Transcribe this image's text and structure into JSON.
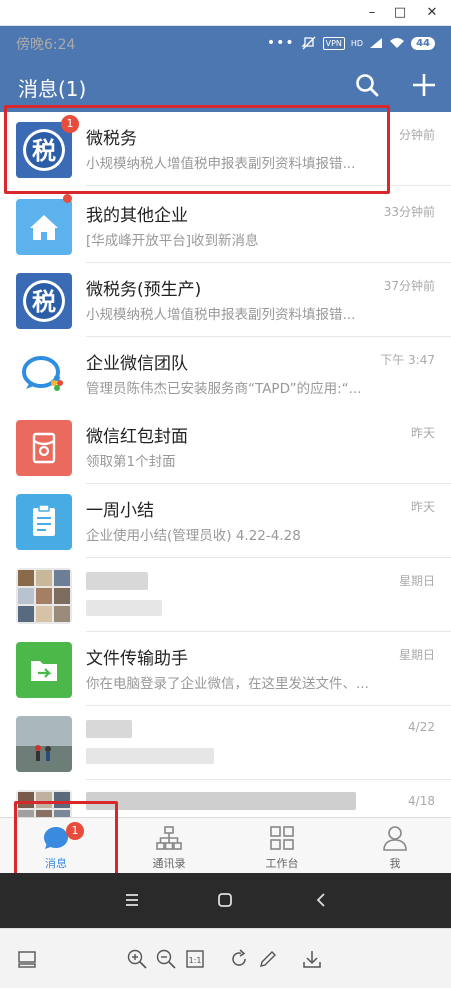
{
  "window": {
    "minimize": "–",
    "maximize": "□",
    "close": "✕"
  },
  "status_bar": {
    "time": "傍晚6:24",
    "vpn": "VPN",
    "hd": "HD",
    "battery": "44",
    "dots": "•••"
  },
  "header": {
    "title": "消息(1)",
    "icons": [
      "search-icon",
      "plus-icon"
    ]
  },
  "messages": [
    {
      "name": "微税务",
      "preview": "小规模纳税人增值税申报表副列资料填报错...",
      "time": "分钟前",
      "badge": "1",
      "avatar": "tax-icon",
      "avatar_color": "#2c5ea8"
    },
    {
      "name": "我的其他企业",
      "preview": "[华成峰开放平台]收到新消息",
      "time": "33分钟前",
      "avatar": "home-icon",
      "avatar_color": "#5bb2ec"
    },
    {
      "name": "微税务(预生产)",
      "preview": "小规模纳税人增值税申报表副列资料填报错...",
      "time": "37分钟前",
      "avatar": "tax-icon",
      "avatar_color": "#2c5ea8"
    },
    {
      "name": "企业微信团队",
      "preview": "管理员陈伟杰已安装服务商“TAPD”的应用:“...",
      "time": "下午 3:47",
      "avatar": "wework-logo-icon"
    },
    {
      "name": "微信红包封面",
      "preview": "领取第1个封面",
      "time": "昨天",
      "avatar": "red-packet-icon",
      "avatar_color": "#ea6a5d"
    },
    {
      "name": "一周小结",
      "preview": "企业使用小结(管理员收) 4.22-4.28",
      "time": "昨天",
      "avatar": "clipboard-icon",
      "avatar_color": "#48abe3"
    },
    {
      "name": "",
      "preview": "",
      "time": "星期日",
      "avatar": "group-avatar-icon"
    },
    {
      "name": "文件传输助手",
      "preview": "你在电脑登录了企业微信，在这里发送文件、...",
      "time": "星期日",
      "avatar": "folder-transfer-icon",
      "avatar_color": "#4cb849"
    },
    {
      "name": "",
      "preview": "",
      "time": "4/22",
      "avatar": "photo-avatar-icon"
    },
    {
      "name": "",
      "preview": "",
      "time": "4/18",
      "avatar": "group-avatar-icon"
    }
  ],
  "tabs": [
    {
      "label": "消息",
      "icon": "chat-bubble-icon",
      "badge": "1",
      "active": true
    },
    {
      "label": "通讯录",
      "icon": "org-chart-icon"
    },
    {
      "label": "工作台",
      "icon": "grid-icon"
    },
    {
      "label": "我",
      "icon": "person-icon"
    }
  ],
  "android_nav": [
    "menu-icon",
    "home-square-icon",
    "back-chevron-icon"
  ],
  "emulator_toolbar": [
    "screen-icon",
    "zoom-in-icon",
    "zoom-out-icon",
    "actual-size-icon",
    "rotate-icon",
    "pen-icon",
    "download-icon"
  ],
  "colors": {
    "brand_blue": "#4d77b0",
    "badge_red": "#e74c3c",
    "highlight_red": "#d9282b"
  }
}
